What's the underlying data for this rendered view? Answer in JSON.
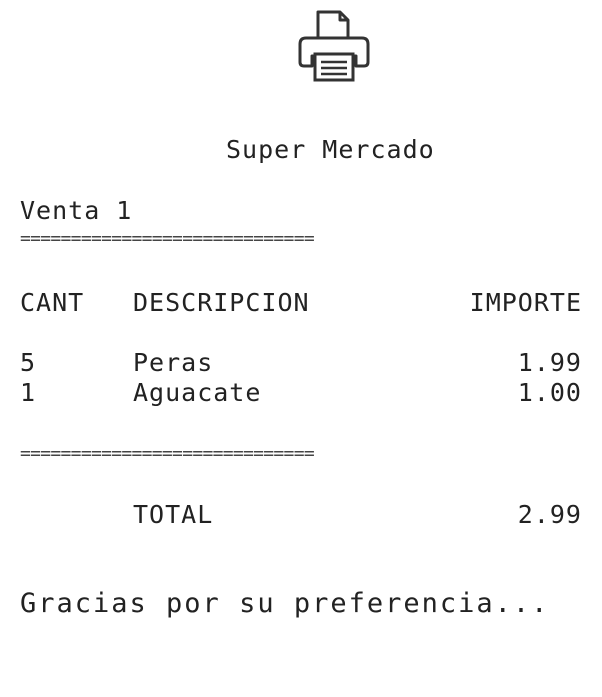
{
  "icons": {
    "printer": "printer-icon"
  },
  "receipt": {
    "store_name": "Super Mercado",
    "sale_label": "Venta 1",
    "divider_top": "=============================",
    "divider_bottom": "=============================",
    "columns": {
      "qty": "CANT",
      "description": "DESCRIPCION",
      "amount": "IMPORTE"
    },
    "items": [
      {
        "qty": "5",
        "description": "Peras",
        "amount": "1.99"
      },
      {
        "qty": "1",
        "description": "Aguacate",
        "amount": "1.00"
      }
    ],
    "total_label": "TOTAL",
    "total_value": "2.99",
    "thanks": "Gracias por su preferencia..."
  }
}
